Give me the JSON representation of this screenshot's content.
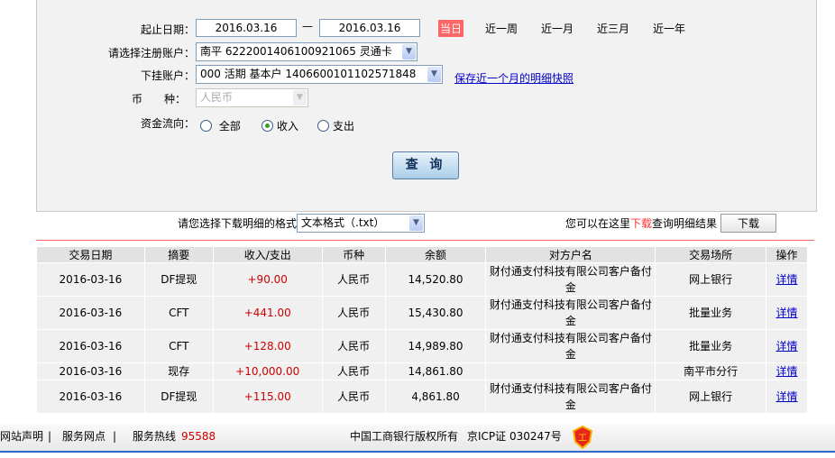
{
  "form": {
    "date_label": "起止日期：",
    "start_date": "2016.03.16",
    "dash": "—",
    "end_date": "2016.03.16",
    "quick": [
      {
        "label": "当日",
        "active": true
      },
      {
        "label": "近一周"
      },
      {
        "label": "近一月"
      },
      {
        "label": "近三月"
      },
      {
        "label": "近一年"
      }
    ],
    "account_label": "请选择注册账户：",
    "account_value": "南平 6222001406100921065 灵通卡",
    "sub_label": "下挂账户：",
    "sub_value": "000 活期 基本户 1406600101102571848",
    "snapshot_link": "保存近一个月的明细快照",
    "currency_label": "币　　种：",
    "currency_value": "人民币",
    "flow_label": "资金流向：",
    "flow_options": [
      {
        "label": "全部",
        "checked": false
      },
      {
        "label": "收入",
        "checked": true
      },
      {
        "label": "支出",
        "checked": false
      }
    ],
    "query_button": "查 询"
  },
  "download": {
    "format_label": "请您选择下载明细的格式",
    "format_value": "文本格式（.txt）",
    "hint_pre": "您可以在这里",
    "hint_link": "下载",
    "hint_post": "查询明细结果",
    "button": "下载"
  },
  "table": {
    "headers": [
      "交易日期",
      "摘要",
      "收入/支出",
      "币种",
      "余额",
      "对方户名",
      "交易场所",
      "操作"
    ],
    "rows": [
      [
        "2016-03-16",
        "DF提现",
        "+90.00",
        "人民币",
        "14,520.80",
        "财付通支付科技有限公司客户备付金",
        "网上银行",
        "详情"
      ],
      [
        "2016-03-16",
        "CFT",
        "+441.00",
        "人民币",
        "15,430.80",
        "财付通支付科技有限公司客户备付金",
        "批量业务",
        "详情"
      ],
      [
        "2016-03-16",
        "CFT",
        "+128.00",
        "人民币",
        "14,989.80",
        "财付通支付科技有限公司客户备付金",
        "批量业务",
        "详情"
      ],
      [
        "2016-03-16",
        "现存",
        "+10,000.00",
        "人民币",
        "14,861.80",
        "",
        "南平市分行",
        "详情"
      ],
      [
        "2016-03-16",
        "DF提现",
        "+115.00",
        "人民币",
        "4,861.80",
        "财付通支付科技有限公司客户备付金",
        "网上银行",
        "详情"
      ]
    ]
  },
  "footer": {
    "links": [
      "网站声明",
      "服务网点"
    ],
    "sep": "|",
    "hotline_label": "服务热线",
    "hotline": "95588",
    "copyright": "中国工商银行版权所有",
    "icp": "京ICP证 030247号"
  },
  "colors": {
    "accent_red": "#ff6666",
    "link": "#0000cc",
    "amount": "#cc0000"
  }
}
